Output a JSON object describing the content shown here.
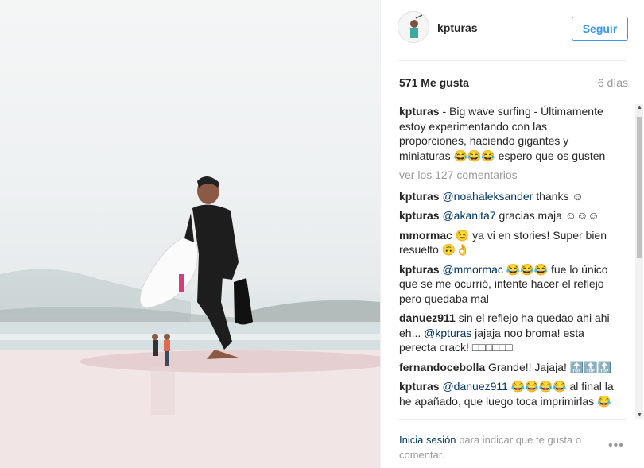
{
  "post": {
    "username": "kpturas",
    "follow_label": "Seguir",
    "likes": "571 Me gusta",
    "age": "6 días",
    "caption": "- Big wave surfing - Últimamente estoy experimentando con las proporciones, haciendo gigantes y miniaturas 😂😂😂 espero que os gusten",
    "view_all": "ver los 127 comentarios"
  },
  "comments": [
    {
      "user": "kpturas",
      "mention": "@noahaleksander",
      "text": " thanks ☺"
    },
    {
      "user": "kpturas",
      "mention": "@akanita7",
      "text": " gracias maja ☺☺☺"
    },
    {
      "user": "mmormac",
      "mention": "",
      "text": "😉 ya vi en stories! Super bien resuelto 🙃👌"
    },
    {
      "user": "kpturas",
      "mention": "@mmormac",
      "text": " 😂😂😂 fue lo único que se me ocurrió, intente hacer el reflejo pero quedaba mal"
    },
    {
      "user": "danuez911",
      "mention": "",
      "text": "sin el reflejo ha quedao ahi ahi eh... ",
      "mention2": "@kpturas",
      "text2": " jajaja noo broma! esta perecta crack! □□□□□□"
    },
    {
      "user": "fernandocebolla",
      "mention": "",
      "text": "Grande!! Jajaja! 🔝🔝🔝"
    },
    {
      "user": "kpturas",
      "mention": "@danuez911",
      "text": " 😂😂😂😂 al final la he apañado, que luego toca imprimirlas 😂"
    }
  ],
  "footer": {
    "login_link": "Inicia sesión",
    "login_text": " para indicar que te gusta o comentar.",
    "more_icon": "•••"
  }
}
